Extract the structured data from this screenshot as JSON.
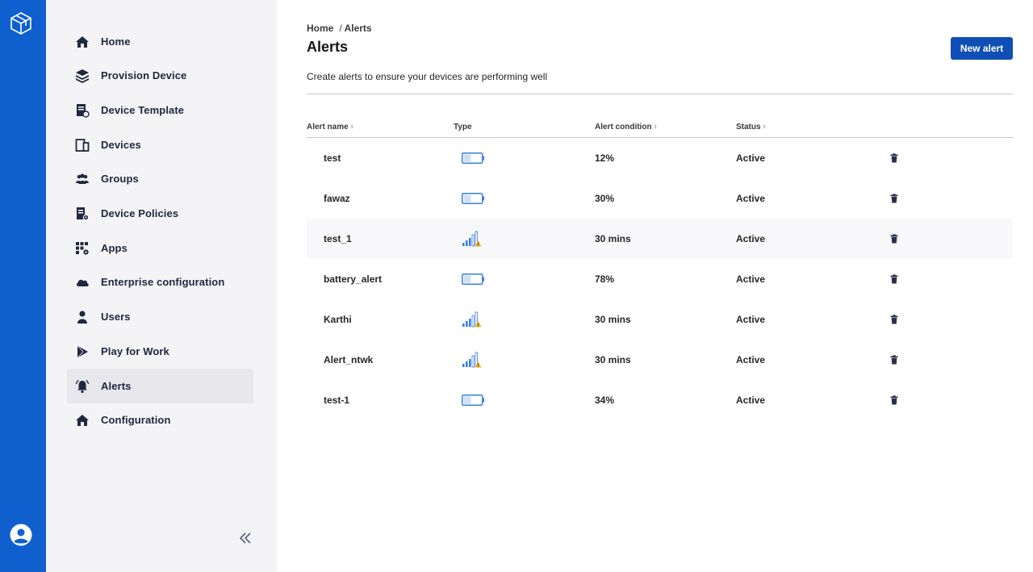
{
  "colors": {
    "rail": "#0f5fcf",
    "primary_button": "#0f4fb5",
    "sidebar_bg": "#f4f4f6",
    "active_bg": "#e7e7ec",
    "nav_text": "#20283f"
  },
  "rail": {
    "logo_icon": "cube-logo-icon",
    "profile_icon": "user-avatar-icon"
  },
  "sidebar": {
    "items": [
      {
        "label": "Home",
        "icon": "home-icon"
      },
      {
        "label": "Provision Device",
        "icon": "layers-icon"
      },
      {
        "label": "Device Template",
        "icon": "template-icon"
      },
      {
        "label": "Devices",
        "icon": "devices-icon"
      },
      {
        "label": "Groups",
        "icon": "groups-icon"
      },
      {
        "label": "Device Policies",
        "icon": "policy-icon"
      },
      {
        "label": "Apps",
        "icon": "apps-icon"
      },
      {
        "label": "Enterprise configuration",
        "icon": "cloud-icon"
      },
      {
        "label": "Users",
        "icon": "user-icon"
      },
      {
        "label": "Play for Work",
        "icon": "play-icon"
      },
      {
        "label": "Alerts",
        "icon": "bell-icon",
        "active": true
      },
      {
        "label": "Configuration",
        "icon": "home-icon"
      }
    ],
    "collapse_icon": "double-chevron-left-icon"
  },
  "breadcrumb": {
    "home": "Home",
    "separator": "/",
    "current": "Alerts"
  },
  "page": {
    "title": "Alerts",
    "new_button": "New alert",
    "description": "Create alerts to ensure your devices are performing well"
  },
  "table": {
    "headers": {
      "name": "Alert name",
      "type": "Type",
      "condition": "Alert condition",
      "status": "Status"
    },
    "rows": [
      {
        "name": "test",
        "type": "battery",
        "condition": "12%",
        "status": "Active"
      },
      {
        "name": "fawaz",
        "type": "battery",
        "condition": "30%",
        "status": "Active"
      },
      {
        "name": "test_1",
        "type": "network",
        "condition": "30 mins",
        "status": "Active"
      },
      {
        "name": "battery_alert",
        "type": "battery",
        "condition": "78%",
        "status": "Active"
      },
      {
        "name": "Karthi",
        "type": "network",
        "condition": "30 mins",
        "status": "Active"
      },
      {
        "name": "Alert_ntwk",
        "type": "network",
        "condition": "30 mins",
        "status": "Active"
      },
      {
        "name": "test-1",
        "type": "battery",
        "condition": "34%",
        "status": "Active"
      }
    ]
  }
}
